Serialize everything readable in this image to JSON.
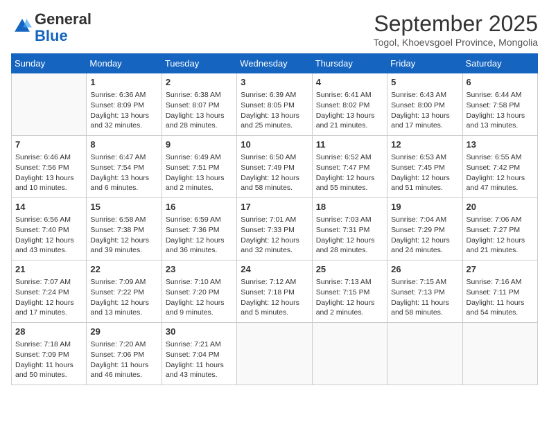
{
  "logo": {
    "general": "General",
    "blue": "Blue"
  },
  "title": "September 2025",
  "subtitle": "Togol, Khoevsgoel Province, Mongolia",
  "weekdays": [
    "Sunday",
    "Monday",
    "Tuesday",
    "Wednesday",
    "Thursday",
    "Friday",
    "Saturday"
  ],
  "weeks": [
    [
      {
        "day": "",
        "info": ""
      },
      {
        "day": "1",
        "info": "Sunrise: 6:36 AM\nSunset: 8:09 PM\nDaylight: 13 hours\nand 32 minutes."
      },
      {
        "day": "2",
        "info": "Sunrise: 6:38 AM\nSunset: 8:07 PM\nDaylight: 13 hours\nand 28 minutes."
      },
      {
        "day": "3",
        "info": "Sunrise: 6:39 AM\nSunset: 8:05 PM\nDaylight: 13 hours\nand 25 minutes."
      },
      {
        "day": "4",
        "info": "Sunrise: 6:41 AM\nSunset: 8:02 PM\nDaylight: 13 hours\nand 21 minutes."
      },
      {
        "day": "5",
        "info": "Sunrise: 6:43 AM\nSunset: 8:00 PM\nDaylight: 13 hours\nand 17 minutes."
      },
      {
        "day": "6",
        "info": "Sunrise: 6:44 AM\nSunset: 7:58 PM\nDaylight: 13 hours\nand 13 minutes."
      }
    ],
    [
      {
        "day": "7",
        "info": "Sunrise: 6:46 AM\nSunset: 7:56 PM\nDaylight: 13 hours\nand 10 minutes."
      },
      {
        "day": "8",
        "info": "Sunrise: 6:47 AM\nSunset: 7:54 PM\nDaylight: 13 hours\nand 6 minutes."
      },
      {
        "day": "9",
        "info": "Sunrise: 6:49 AM\nSunset: 7:51 PM\nDaylight: 13 hours\nand 2 minutes."
      },
      {
        "day": "10",
        "info": "Sunrise: 6:50 AM\nSunset: 7:49 PM\nDaylight: 12 hours\nand 58 minutes."
      },
      {
        "day": "11",
        "info": "Sunrise: 6:52 AM\nSunset: 7:47 PM\nDaylight: 12 hours\nand 55 minutes."
      },
      {
        "day": "12",
        "info": "Sunrise: 6:53 AM\nSunset: 7:45 PM\nDaylight: 12 hours\nand 51 minutes."
      },
      {
        "day": "13",
        "info": "Sunrise: 6:55 AM\nSunset: 7:42 PM\nDaylight: 12 hours\nand 47 minutes."
      }
    ],
    [
      {
        "day": "14",
        "info": "Sunrise: 6:56 AM\nSunset: 7:40 PM\nDaylight: 12 hours\nand 43 minutes."
      },
      {
        "day": "15",
        "info": "Sunrise: 6:58 AM\nSunset: 7:38 PM\nDaylight: 12 hours\nand 39 minutes."
      },
      {
        "day": "16",
        "info": "Sunrise: 6:59 AM\nSunset: 7:36 PM\nDaylight: 12 hours\nand 36 minutes."
      },
      {
        "day": "17",
        "info": "Sunrise: 7:01 AM\nSunset: 7:33 PM\nDaylight: 12 hours\nand 32 minutes."
      },
      {
        "day": "18",
        "info": "Sunrise: 7:03 AM\nSunset: 7:31 PM\nDaylight: 12 hours\nand 28 minutes."
      },
      {
        "day": "19",
        "info": "Sunrise: 7:04 AM\nSunset: 7:29 PM\nDaylight: 12 hours\nand 24 minutes."
      },
      {
        "day": "20",
        "info": "Sunrise: 7:06 AM\nSunset: 7:27 PM\nDaylight: 12 hours\nand 21 minutes."
      }
    ],
    [
      {
        "day": "21",
        "info": "Sunrise: 7:07 AM\nSunset: 7:24 PM\nDaylight: 12 hours\nand 17 minutes."
      },
      {
        "day": "22",
        "info": "Sunrise: 7:09 AM\nSunset: 7:22 PM\nDaylight: 12 hours\nand 13 minutes."
      },
      {
        "day": "23",
        "info": "Sunrise: 7:10 AM\nSunset: 7:20 PM\nDaylight: 12 hours\nand 9 minutes."
      },
      {
        "day": "24",
        "info": "Sunrise: 7:12 AM\nSunset: 7:18 PM\nDaylight: 12 hours\nand 5 minutes."
      },
      {
        "day": "25",
        "info": "Sunrise: 7:13 AM\nSunset: 7:15 PM\nDaylight: 12 hours\nand 2 minutes."
      },
      {
        "day": "26",
        "info": "Sunrise: 7:15 AM\nSunset: 7:13 PM\nDaylight: 11 hours\nand 58 minutes."
      },
      {
        "day": "27",
        "info": "Sunrise: 7:16 AM\nSunset: 7:11 PM\nDaylight: 11 hours\nand 54 minutes."
      }
    ],
    [
      {
        "day": "28",
        "info": "Sunrise: 7:18 AM\nSunset: 7:09 PM\nDaylight: 11 hours\nand 50 minutes."
      },
      {
        "day": "29",
        "info": "Sunrise: 7:20 AM\nSunset: 7:06 PM\nDaylight: 11 hours\nand 46 minutes."
      },
      {
        "day": "30",
        "info": "Sunrise: 7:21 AM\nSunset: 7:04 PM\nDaylight: 11 hours\nand 43 minutes."
      },
      {
        "day": "",
        "info": ""
      },
      {
        "day": "",
        "info": ""
      },
      {
        "day": "",
        "info": ""
      },
      {
        "day": "",
        "info": ""
      }
    ]
  ]
}
